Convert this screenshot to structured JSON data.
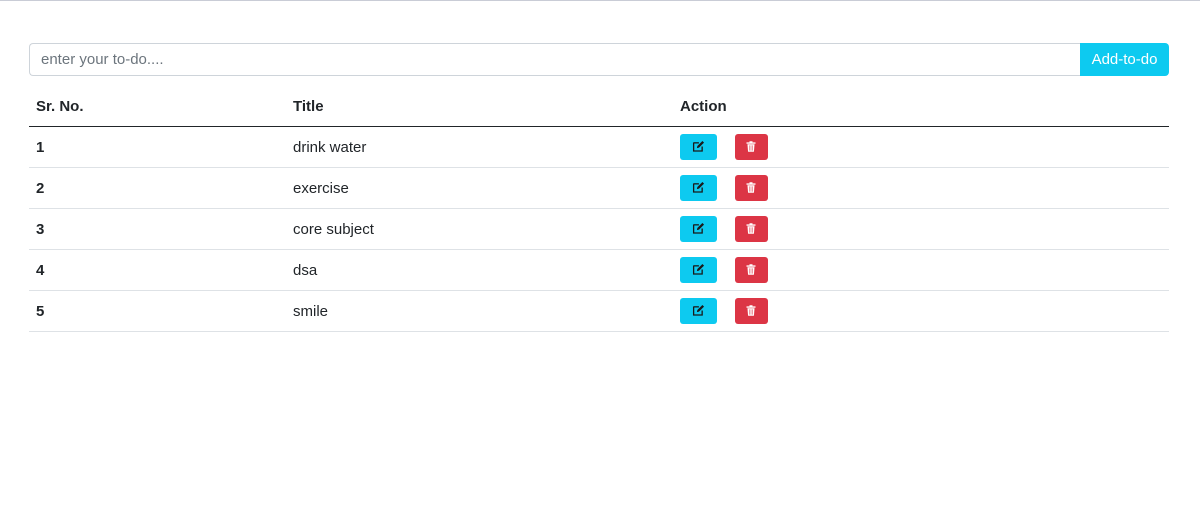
{
  "todo_form": {
    "input_value": "",
    "input_placeholder": "enter your to-do....",
    "add_button_label": "Add-to-do"
  },
  "table": {
    "headers": {
      "sr_no": "Sr. No.",
      "title": "Title",
      "action": "Action"
    },
    "rows": [
      {
        "sr_no": "1",
        "title": "drink water"
      },
      {
        "sr_no": "2",
        "title": "exercise"
      },
      {
        "sr_no": "3",
        "title": "core subject"
      },
      {
        "sr_no": "4",
        "title": "dsa"
      },
      {
        "sr_no": "5",
        "title": "smile"
      }
    ]
  },
  "icons": {
    "edit": "edit-icon",
    "delete": "trash-icon"
  },
  "colors": {
    "info": "#0dcaf0",
    "danger": "#dc3545"
  }
}
